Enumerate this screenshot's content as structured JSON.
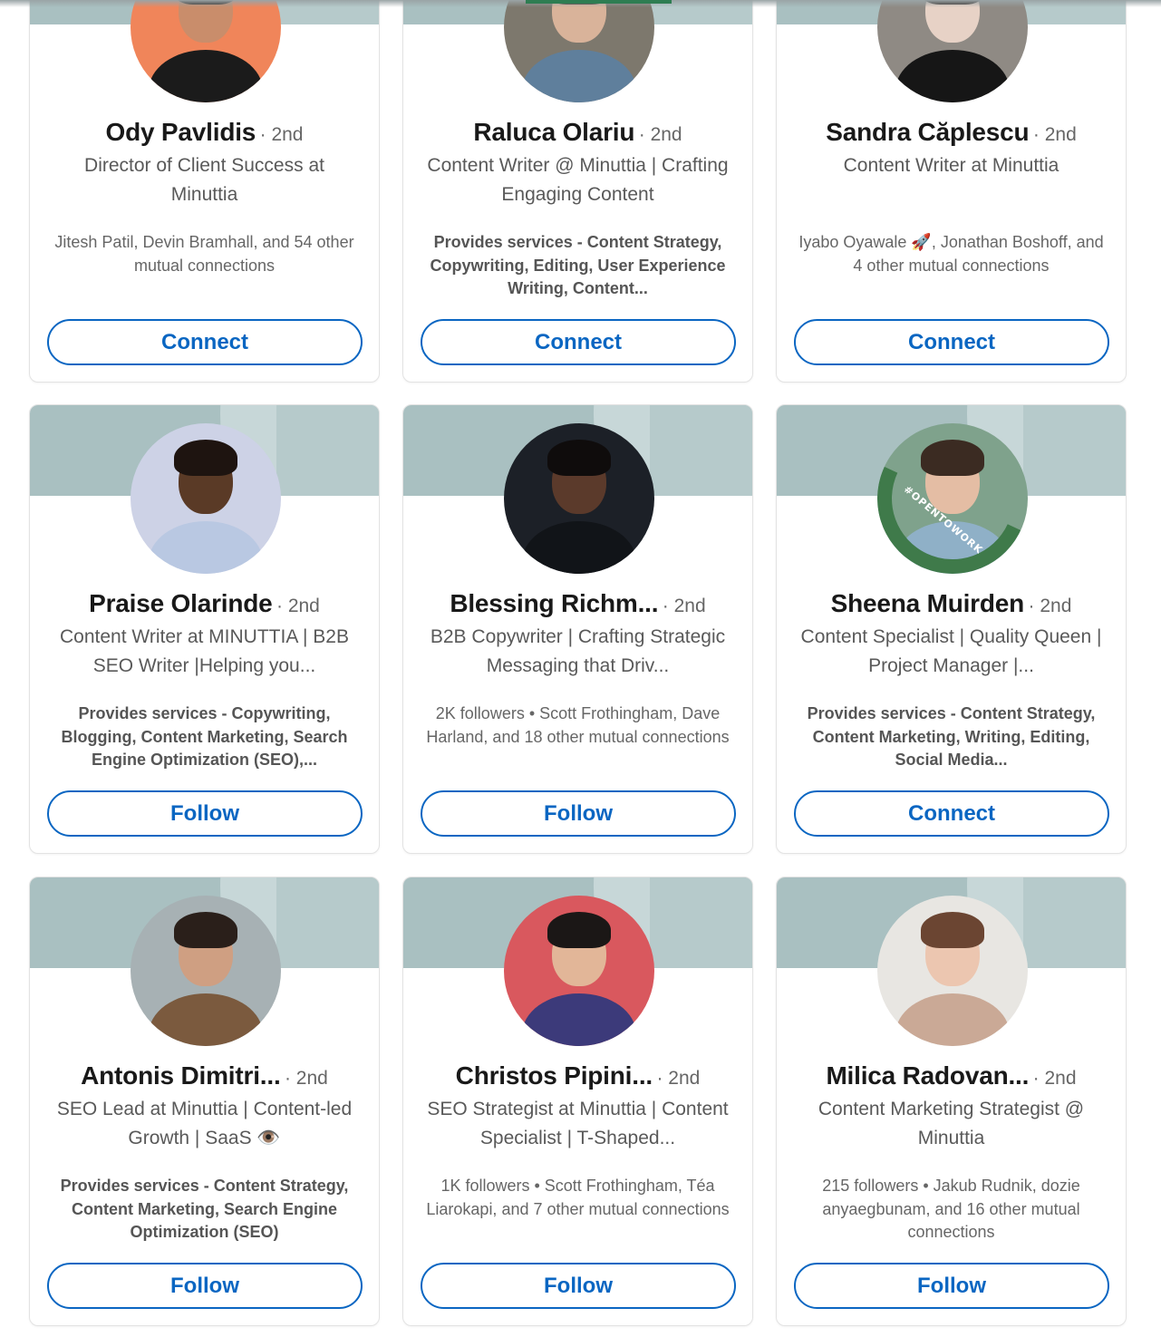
{
  "cards": [
    {
      "name": "Ody Pavlidis",
      "degree": "· 2nd",
      "headline": "Director of Client Success at Minuttia",
      "meta": "Jitesh Patil, Devin Bramhall, and 54 other mutual connections",
      "action": "Connect",
      "avatar": {
        "bg": "#f0855a",
        "skin": "#c98d6b",
        "hair": "#2b2420",
        "clothes": "#1b1b1b"
      }
    },
    {
      "name": "Raluca Olariu",
      "degree": "· 2nd",
      "headline": "Content Writer @ Minuttia | Crafting Engaging Content",
      "meta": "Provides services - Content Strategy, Copywriting, Editing, User Experience Writing, Content...",
      "action": "Connect",
      "avatar": {
        "bg": "#7d786d",
        "skin": "#d9b39a",
        "hair": "#3a2a20",
        "clothes": "#5f7f9c"
      }
    },
    {
      "name": "Sandra Căplescu",
      "degree": "· 2nd",
      "headline": "Content Writer at Minuttia",
      "meta": "Iyabo Oyawale 🚀, Jonathan Boshoff, and 4 other mutual connections",
      "action": "Connect",
      "avatar": {
        "bg": "#8f8a84",
        "skin": "#e7d2c6",
        "hair": "#2f2622",
        "clothes": "#161616"
      }
    },
    {
      "name": "Praise Olarinde",
      "degree": "· 2nd",
      "headline": "Content Writer at MINUTTIA | B2B SEO Writer |Helping you...",
      "meta": "Provides services - Copywriting, Blogging, Content Marketing, Search Engine Optimization (SEO),...",
      "action": "Follow",
      "avatar": {
        "bg": "#cdd2e6",
        "skin": "#5a3a26",
        "hair": "#1e1410",
        "clothes": "#b9c8e2"
      }
    },
    {
      "name": "Blessing Richm...",
      "degree": "· 2nd",
      "headline": "B2B Copywriter | Crafting Strategic Messaging that Driv...",
      "meta": "2K followers • Scott Frothingham, Dave Harland, and 18 other mutual connections",
      "action": "Follow",
      "avatar": {
        "bg": "#1c2027",
        "skin": "#5b3a2b",
        "hair": "#0f0c0c",
        "clothes": "#111418"
      }
    },
    {
      "name": "Sheena Muirden",
      "degree": "· 2nd",
      "headline": "Content Specialist | Quality Queen | Project Manager |...",
      "meta": "Provides services - Content Strategy, Content Marketing, Writing, Editing, Social Media...",
      "action": "Connect",
      "open_to_work": "#OPENTOWORK",
      "avatar": {
        "bg": "#7fa28c",
        "skin": "#e4bda4",
        "hair": "#3b2b22",
        "clothes": "#8fb0c7"
      }
    },
    {
      "name": "Antonis Dimitri...",
      "degree": "· 2nd",
      "headline": "SEO Lead at Minuttia | Content-led Growth | SaaS 👁️",
      "meta": "Provides services - Content Strategy, Content Marketing, Search Engine Optimization (SEO)",
      "action": "Follow",
      "avatar": {
        "bg": "#a7b1b4",
        "skin": "#cf9f82",
        "hair": "#2a1f1a",
        "clothes": "#7b5a3e"
      }
    },
    {
      "name": "Christos Pipini...",
      "degree": "· 2nd",
      "headline": "SEO Strategist at Minuttia | Content Specialist | T-Shaped...",
      "meta": "1K followers • Scott Frothingham, Téa Liarokapi, and 7 other mutual connections",
      "action": "Follow",
      "avatar": {
        "bg": "#d9585e",
        "skin": "#e2b698",
        "hair": "#1b1716",
        "clothes": "#3c3a7a"
      }
    },
    {
      "name": "Milica Radovan...",
      "degree": "· 2nd",
      "headline": "Content Marketing Strategist @ Minuttia",
      "meta": "215 followers • Jakub Rudnik, dozie anyaegbunam, and 16 other mutual connections",
      "action": "Follow",
      "avatar": {
        "bg": "#e8e6e2",
        "skin": "#ecc6b0",
        "hair": "#6b4532",
        "clothes": "#caa996"
      }
    }
  ]
}
